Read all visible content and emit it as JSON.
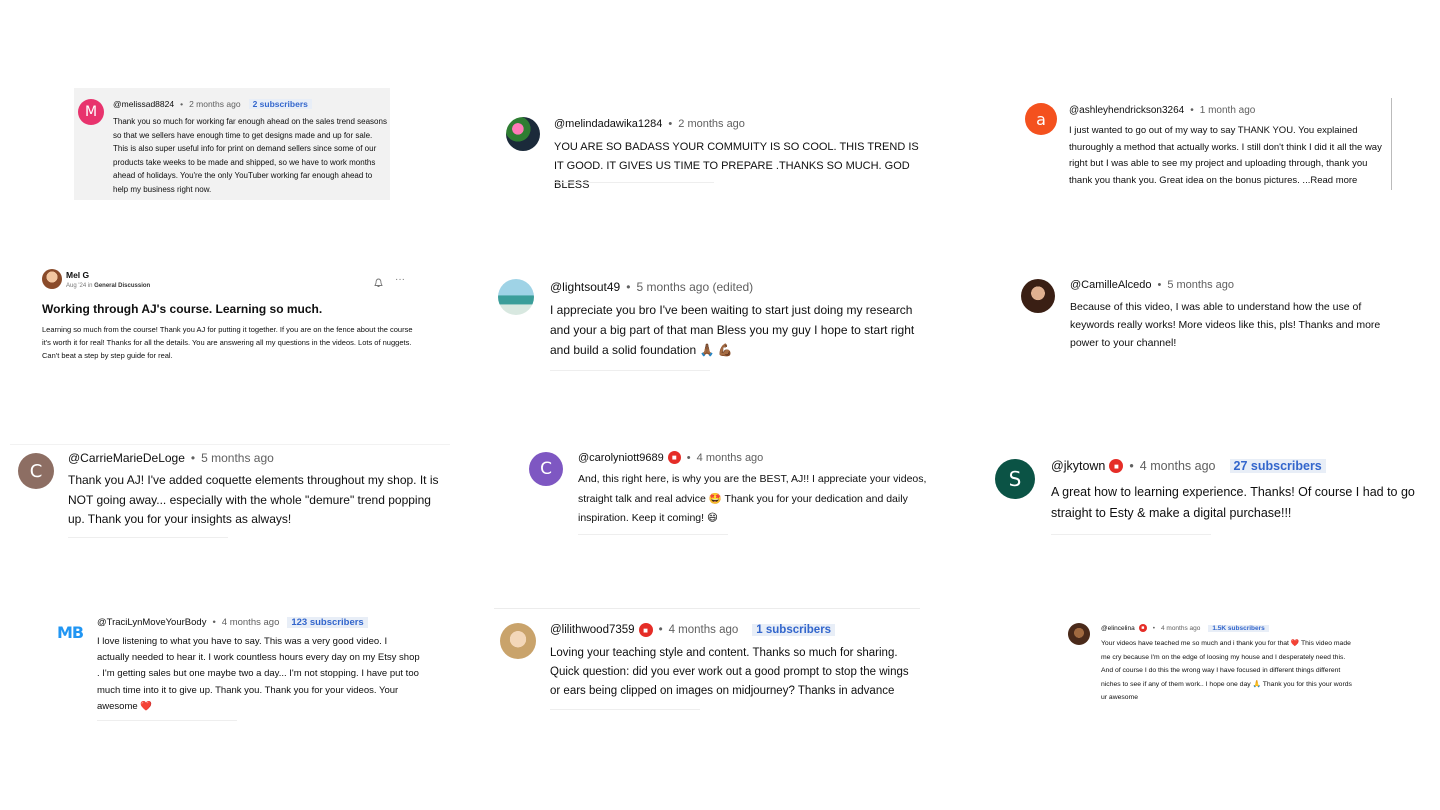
{
  "comments": [
    {
      "handle": "@melissad8824",
      "time": "2 months ago",
      "badge": "2 subscribers",
      "avatar_letter": "M",
      "avatar_color": "#e8336d",
      "text": "Thank you so much for working far enough ahead on the sales trend seasons so that we sellers have enough time to get designs made and up for sale. This is also super useful info for print on demand sellers since some of our products take weeks to be made and shipped, so we have to work months ahead of holidays. You're the only YouTuber working far enough ahead to help my business right now."
    },
    {
      "handle": "@melindadawika1284",
      "time": "2 months ago",
      "text": "YOU ARE SO BADASS YOUR COMMUITY IS SO COOL.  THIS TREND IS IT GOOD.  IT GIVES US TIME TO PREPARE .THANKS SO MUCH. GOD BLESS"
    },
    {
      "handle": "@ashleyhendrickson3264",
      "time": "1 month ago",
      "avatar_letter": "a",
      "avatar_color": "#f4511e",
      "text": "I just wanted to go out of my way to say THANK YOU. You explained thuroughly a method that actually works. I still don't think I did it all the way right but I was able to see my project and uploading through, thank you thank you thank you. Great idea on the bonus pictures. ...Read more"
    },
    {
      "author": "Mel G",
      "date": "Aug '24 in",
      "category": "General Discussion",
      "title": "Working through AJ's course. Learning so much.",
      "text": "Learning so much from the course! Thank you AJ for putting it together. If you are on the fence about the course it's worth it for real! Thanks for all the details. You are answering all my questions in the videos. Lots of nuggets. Can't beat a step by step guide for real.",
      "menu": "···"
    },
    {
      "handle": "@lightsout49",
      "time": "5 months ago (edited)",
      "text": "I appreciate you bro I've been waiting to start just doing my research and your a big part of that man Bless you my guy I hope to start right and build a solid foundation 🙏🏾 💪🏾"
    },
    {
      "handle": "@CamilleAlcedo",
      "time": "5 months ago",
      "text": "Because of this video, I was able to understand how the use of keywords really works! More videos like this, pls! Thanks and more power to your channel!"
    },
    {
      "handle": "@CarrieMarieDeLoge",
      "time": "5 months ago",
      "avatar_letter": "C",
      "avatar_color": "#8d6e63",
      "text": "Thank you AJ! I've added coquette elements throughout my shop. It is NOT going away... especially with the whole \"demure\" trend popping up. Thank you for your insights as always!"
    },
    {
      "handle": "@carolyniott9689",
      "time": "4 months ago",
      "avatar_letter": "C",
      "avatar_color": "#7e57c2",
      "text": "And, this right here, is why you are the BEST, AJ!! I appreciate your videos, straight talk and real advice 🤩 Thank you for your dedication and daily inspiration. Keep it coming! 😄"
    },
    {
      "handle": "@jkytown",
      "time": "4 months ago",
      "badge": "27 subscribers",
      "avatar_letter": "S",
      "avatar_color": "#0b5345",
      "text": "A great how to learning experience. Thanks! Of course I had to go straight to Esty & make a digital purchase!!!"
    },
    {
      "handle": "@TraciLynMoveYourBody",
      "time": "4 months ago",
      "badge": "123 subscribers",
      "logo": "MB",
      "text": "I love listening to what you have to say. This was a very good video. I actually needed to hear it. I work countless hours every day on my Etsy shop . I'm getting sales but one maybe two a day... I'm not stopping. I have put too much time into it to give up. Thank you. Thank you for your videos. Your awesome ❤️"
    },
    {
      "handle": "@lilithwood7359",
      "time": "4 months ago",
      "badge": "1 subscribers",
      "text": "Loving your teaching style and content. Thanks so much for sharing. Quick question: did you ever work out a good prompt to stop the wings or ears being clipped on images on midjourney? Thanks in advance"
    },
    {
      "handle": "@elincelina",
      "time": "4 months ago",
      "badge": "1.5K subscribers",
      "text": "Your videos have teached me so much and i thank you for that ❤️ This video made me cry because I'm on the edge of loosing my house and I desperately need this. And of course I do this the wrong way I have focused in different things different niches to see if any of them work.. I hope one day 🙏 Thank you for this your words ur awesome"
    }
  ],
  "icons": {
    "bell": "bell-icon",
    "menu": "more-icon",
    "shield": "red-channel-icon"
  }
}
